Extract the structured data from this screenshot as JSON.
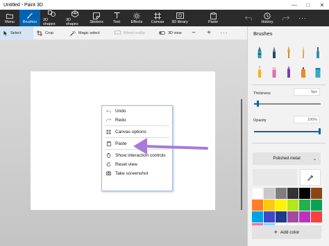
{
  "window": {
    "title": "Untitled - Paint 3D"
  },
  "ribbon": {
    "items": [
      {
        "label": "Menu",
        "icon": "folder-icon"
      },
      {
        "label": "Brushes",
        "icon": "brush-icon"
      },
      {
        "label": "2D shapes",
        "icon": "2d-shapes-icon"
      },
      {
        "label": "3D shapes",
        "icon": "3d-shapes-icon"
      },
      {
        "label": "Stickers",
        "icon": "stickers-icon"
      },
      {
        "label": "Text",
        "icon": "text-icon"
      },
      {
        "label": "Effects",
        "icon": "effects-icon"
      },
      {
        "label": "Canvas",
        "icon": "canvas-icon"
      },
      {
        "label": "3D library",
        "icon": "3d-library-icon"
      },
      {
        "label": "Paste",
        "icon": "paste-icon"
      },
      {
        "label": "History",
        "icon": "history-icon"
      }
    ]
  },
  "toolbar": {
    "select": "Select",
    "crop": "Crop",
    "magic_select": "Magic select",
    "mixed_reality": "Mixed reality",
    "view_3d": "3D view"
  },
  "context_menu": {
    "undo": "Undo",
    "redo": "Redo",
    "canvas_options": "Canvas options",
    "paste": "Paste",
    "show_interaction_controls": "Show interaction controls",
    "reset_view": "Reset view",
    "take_screenshot": "Take screenshot"
  },
  "panel": {
    "title": "Brushes",
    "thickness_label": "Thickness",
    "thickness_value": "5px",
    "thickness_fraction": 0.05,
    "opacity_label": "Opacity",
    "opacity_value": "100%",
    "opacity_fraction": 1.0,
    "texture": "Polished metal",
    "add_color": "Add color",
    "accent_color": "#0063b1"
  },
  "palette": [
    "#ffffff",
    "#c8c8c8",
    "#7f7f7f",
    "#333333",
    "#000000",
    "#8b4513",
    "#ff7f27",
    "#ffc90e",
    "#fff200",
    "#b5e61d",
    "#22b14c",
    "#00a651",
    "#00a2e8",
    "#3f48cc",
    "#1e3a8a",
    "#a349a4",
    "#c030c0",
    "#ff3e3e",
    "#ff6fa0",
    "#7fd8f8",
    "#ffffff",
    "#ffffff",
    "#ffffff",
    "#ffffff"
  ]
}
